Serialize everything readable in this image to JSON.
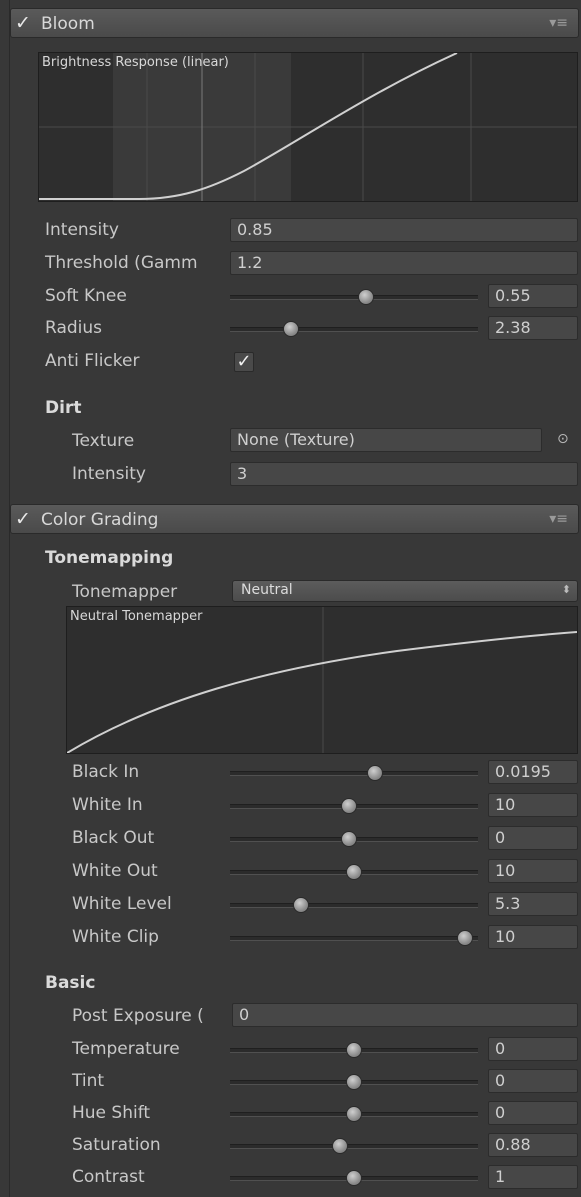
{
  "bloom": {
    "title": "Bloom",
    "check": "✓",
    "menu": "▾≡",
    "graph_title": "Brightness Response (linear)",
    "intensity": {
      "label": "Intensity",
      "value": "0.85"
    },
    "threshold": {
      "label": "Threshold (Gamm",
      "value": "1.2"
    },
    "soft_knee": {
      "label": "Soft Knee",
      "value": "0.55",
      "level": 0.55
    },
    "radius": {
      "label": "Radius",
      "value": "2.38",
      "level": 0.24
    },
    "anti_flicker": {
      "label": "Anti Flicker",
      "checked": true,
      "check": "✓"
    },
    "dirt": {
      "heading": "Dirt",
      "texture": {
        "label": "Texture",
        "value": "None (Texture)",
        "icon": "target-icon"
      },
      "intensity": {
        "label": "Intensity",
        "value": "3"
      }
    }
  },
  "color_grading": {
    "title": "Color Grading",
    "check": "✓",
    "menu": "▾≡",
    "tonemapping": {
      "heading": "Tonemapping",
      "tonemapper": {
        "label": "Tonemapper",
        "value": "Neutral",
        "arrow": "⬍"
      },
      "graph_title": "Neutral Tonemapper",
      "sliders": [
        {
          "label": "Black In",
          "value": "0.0195",
          "level": 0.59
        },
        {
          "label": "White In",
          "value": "10",
          "level": 0.48
        },
        {
          "label": "Black Out",
          "value": "0",
          "level": 0.48
        },
        {
          "label": "White Out",
          "value": "10",
          "level": 0.5
        },
        {
          "label": "White Level",
          "value": "5.3",
          "level": 0.27
        },
        {
          "label": "White Clip",
          "value": "10",
          "level": 0.98
        }
      ]
    },
    "basic": {
      "heading": "Basic",
      "post_exposure": {
        "label": "Post Exposure (",
        "value": "0"
      },
      "sliders": [
        {
          "label": "Temperature",
          "value": "0",
          "level": 0.5
        },
        {
          "label": "Tint",
          "value": "0",
          "level": 0.5
        },
        {
          "label": "Hue Shift",
          "value": "0",
          "level": 0.5
        },
        {
          "label": "Saturation",
          "value": "0.88",
          "level": 0.44
        },
        {
          "label": "Contrast",
          "value": "1",
          "level": 0.5
        }
      ]
    }
  }
}
